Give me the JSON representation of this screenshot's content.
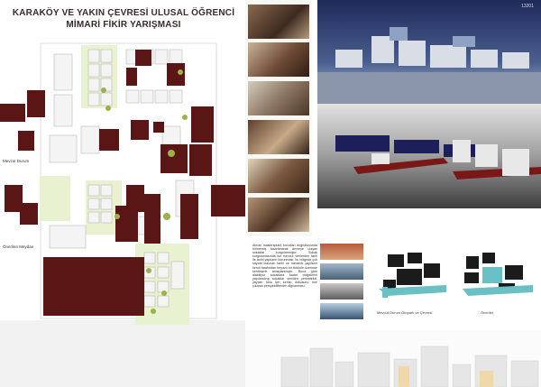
{
  "title": {
    "line1": "KARAKÖY VE YAKIN ÇEVRESİ ULUSAL ÖĞRENCİ",
    "line2": "MİMARİ FİKİR YARIŞMASI"
  },
  "map_labels": {
    "left_upper": "Mevzut Durum",
    "left_lower": "Önerilen Meydan"
  },
  "page_number": "13201",
  "description": "Alman mastersplant konutları doğrultusunda bölmemiş tasarlanarak devreye ulaşan sokaklar kurgulanmıştır. Sokak kurgulamasında ise mevcut verilerden tarih ile tarihi yapıların korunması; bu bölgede çok sayıda bulunan tarihi ve mimarlık yapıların kendi tarafından beyazlı bir bütünle üzerinde kentleşme amaçlanmıştır. Buna göre alabiliyor sokaklara kadar bölgelerini yapılandırıp sokaklar yeniden yerleştirildi; yayılan bina için kentin dokusunu öne çıkaran perspektiflerden algılanması.",
  "captions": {
    "diagram1": "Mevcut Durum Otopark ve Çevresi",
    "diagram2": "Öneriler"
  }
}
